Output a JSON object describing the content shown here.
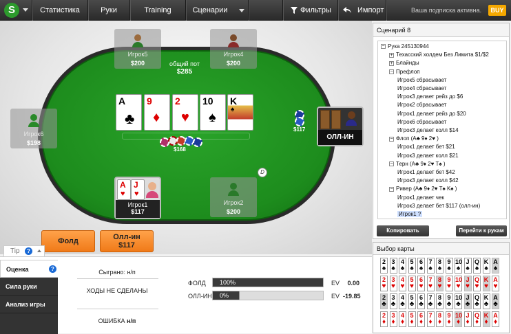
{
  "topbar": {
    "logo": "S",
    "nav": [
      "Статистика",
      "Руки",
      "Training",
      "Сценарии"
    ],
    "filters": "Фильтры",
    "import": "Импорт",
    "subscription": "Ваша подписка активна.",
    "buy": "BUY"
  },
  "table": {
    "pot_label": "общий пот",
    "pot_value": "$285",
    "bet_center": "$168",
    "bet_right": "$117",
    "seats": {
      "p5": {
        "name": "Игрок5",
        "stack": "$200"
      },
      "p4": {
        "name": "Игрок4",
        "stack": "$200"
      },
      "p6": {
        "name": "Игрок6",
        "stack": "$198"
      },
      "p2": {
        "name": "Игрок2",
        "stack": "$200"
      },
      "p1": {
        "name": "Игрок1",
        "stack": "$117"
      },
      "p3": {
        "name": "ОЛЛ-ИН"
      }
    },
    "dealer": "D",
    "board": [
      {
        "rank": "A",
        "suit": "♣",
        "red": false
      },
      {
        "rank": "9",
        "suit": "♦",
        "red": true
      },
      {
        "rank": "2",
        "suit": "♥",
        "red": true
      },
      {
        "rank": "10",
        "suit": "♠",
        "red": false
      },
      {
        "rank": "K",
        "suit": "♠",
        "red": false
      }
    ],
    "hero_cards": [
      {
        "rank": "A",
        "suit": "♥",
        "red": true
      },
      {
        "rank": "J",
        "suit": "♥",
        "red": true
      }
    ]
  },
  "actions": {
    "fold": "Фолд",
    "allin": "Олл-ин",
    "allin_amount": "$117"
  },
  "tip": {
    "label": "Tip",
    "tabs": [
      "Оценка",
      "Сила руки",
      "Анализ игры"
    ],
    "played": "Сыграно: н/п",
    "no_moves": "ХОДЫ НЕ СДЕЛАНЫ",
    "error_label": "ОШИБКА",
    "error_value": "н/п",
    "rows": [
      {
        "label": "ФОЛД",
        "pct": "100%",
        "fill": 1.0,
        "ev": "EV",
        "value": "0.00"
      },
      {
        "label": "ОЛЛ-ИН",
        "pct": "0%",
        "fill": 0.0,
        "ev": "EV",
        "value": "-19.85"
      }
    ]
  },
  "scenario": {
    "title": "Сценарий 8",
    "tree": [
      {
        "t": "Рука 245130944",
        "tog": "−"
      },
      {
        "t": "Техасский холдем Без Лимита $1/$2",
        "tog": "+"
      },
      {
        "t": "Блайнды",
        "tog": "+"
      },
      {
        "t": "Префлоп",
        "tog": "−"
      },
      {
        "t": "Игрок5 сбрасывает"
      },
      {
        "t": "Игрок4 сбрасывает"
      },
      {
        "t": "Игрок3 делает рейз до $6"
      },
      {
        "t": "Игрок2 сбрасывает"
      },
      {
        "t": "Игрок1 делает рейз до $20"
      },
      {
        "t": "Игрок6 сбрасывает"
      },
      {
        "t": "Игрок3 делает колл $14"
      },
      {
        "t": "Флоп (A♣ 9♦ 2♥ )",
        "tog": "−"
      },
      {
        "t": "Игрок1 делает бет $21"
      },
      {
        "t": "Игрок3 делает колл $21"
      },
      {
        "t": "Терн (A♣ 9♦ 2♥ T♠ )",
        "tog": "−"
      },
      {
        "t": "Игрок1 делает бет $42"
      },
      {
        "t": "Игрок3 делает колл $42"
      },
      {
        "t": "Ривер (A♣ 9♦ 2♥ T♠ K♠ )",
        "tog": "−"
      },
      {
        "t": "Игрок1 делает чек"
      },
      {
        "t": "Игрок3 делает бет $117 (олл-ин)"
      },
      {
        "t": "Игрок1 ?"
      }
    ],
    "copy_btn": "Копировать сценарий",
    "goto_btn": "Перейти к рукам"
  },
  "card_picker": {
    "title": "Выбор карты",
    "ranks": [
      "2",
      "3",
      "4",
      "5",
      "6",
      "7",
      "8",
      "9",
      "10",
      "J",
      "Q",
      "K",
      "A"
    ],
    "suits": [
      "♠",
      "♥",
      "♣",
      "♦"
    ]
  }
}
